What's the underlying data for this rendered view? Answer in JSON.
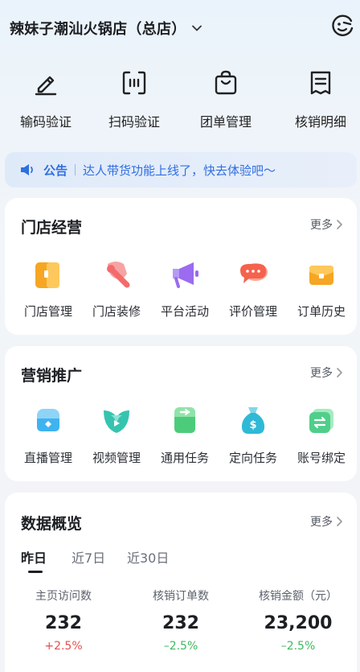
{
  "header": {
    "store_name": "辣妹子潮汕火锅店（总店）",
    "dropdown_icon": "chevron-down-icon",
    "avatar_icon": "face-icon"
  },
  "quick_actions": [
    {
      "label": "输码验证",
      "icon": "pencil-icon"
    },
    {
      "label": "扫码验证",
      "icon": "scan-icon"
    },
    {
      "label": "团单管理",
      "icon": "shopping-bag-icon"
    },
    {
      "label": "核销明细",
      "icon": "receipt-icon"
    }
  ],
  "notice": {
    "tag": "公告",
    "message": "达人带货功能上线了，快去体验吧～",
    "icon": "speaker-icon"
  },
  "store_ops": {
    "title": "门店经营",
    "more": "更多",
    "items": [
      {
        "label": "门店管理",
        "icon": "store-icon",
        "color": "#f6a623"
      },
      {
        "label": "门店装修",
        "icon": "decorate-icon",
        "color": "#f46b6b"
      },
      {
        "label": "平台活动",
        "icon": "megaphone-icon",
        "color": "#9b6bf0"
      },
      {
        "label": "评价管理",
        "icon": "comment-icon",
        "color": "#f5624d"
      },
      {
        "label": "订单历史",
        "icon": "order-icon",
        "color": "#f5a623"
      }
    ]
  },
  "marketing": {
    "title": "营销推广",
    "more": "更多",
    "items": [
      {
        "label": "直播管理",
        "icon": "live-icon",
        "color": "#3fb3f0"
      },
      {
        "label": "视频管理",
        "icon": "video-icon",
        "color": "#35c4b0"
      },
      {
        "label": "通用任务",
        "icon": "task-icon",
        "color": "#4ccc7a"
      },
      {
        "label": "定向任务",
        "icon": "money-bag-icon",
        "color": "#2fb9d6"
      },
      {
        "label": "账号绑定",
        "icon": "bind-icon",
        "color": "#4fcf8a"
      }
    ]
  },
  "data_overview": {
    "title": "数据概览",
    "more": "更多",
    "tabs": [
      "昨日",
      "近7日",
      "近30日"
    ],
    "active_tab": "昨日",
    "stats": [
      {
        "label": "主页访问数",
        "value": "232",
        "change": "+2.5%",
        "trend": "up"
      },
      {
        "label": "核销订单数",
        "value": "232",
        "change": "–2.5%",
        "trend": "down"
      },
      {
        "label": "核销金额（元）",
        "value": "23,200",
        "change": "–2.5%",
        "trend": "down"
      }
    ]
  },
  "colors": {
    "accent_blue": "#2f6fe0",
    "increase_red": "#ea4d4d",
    "decrease_green": "#40b85f"
  }
}
